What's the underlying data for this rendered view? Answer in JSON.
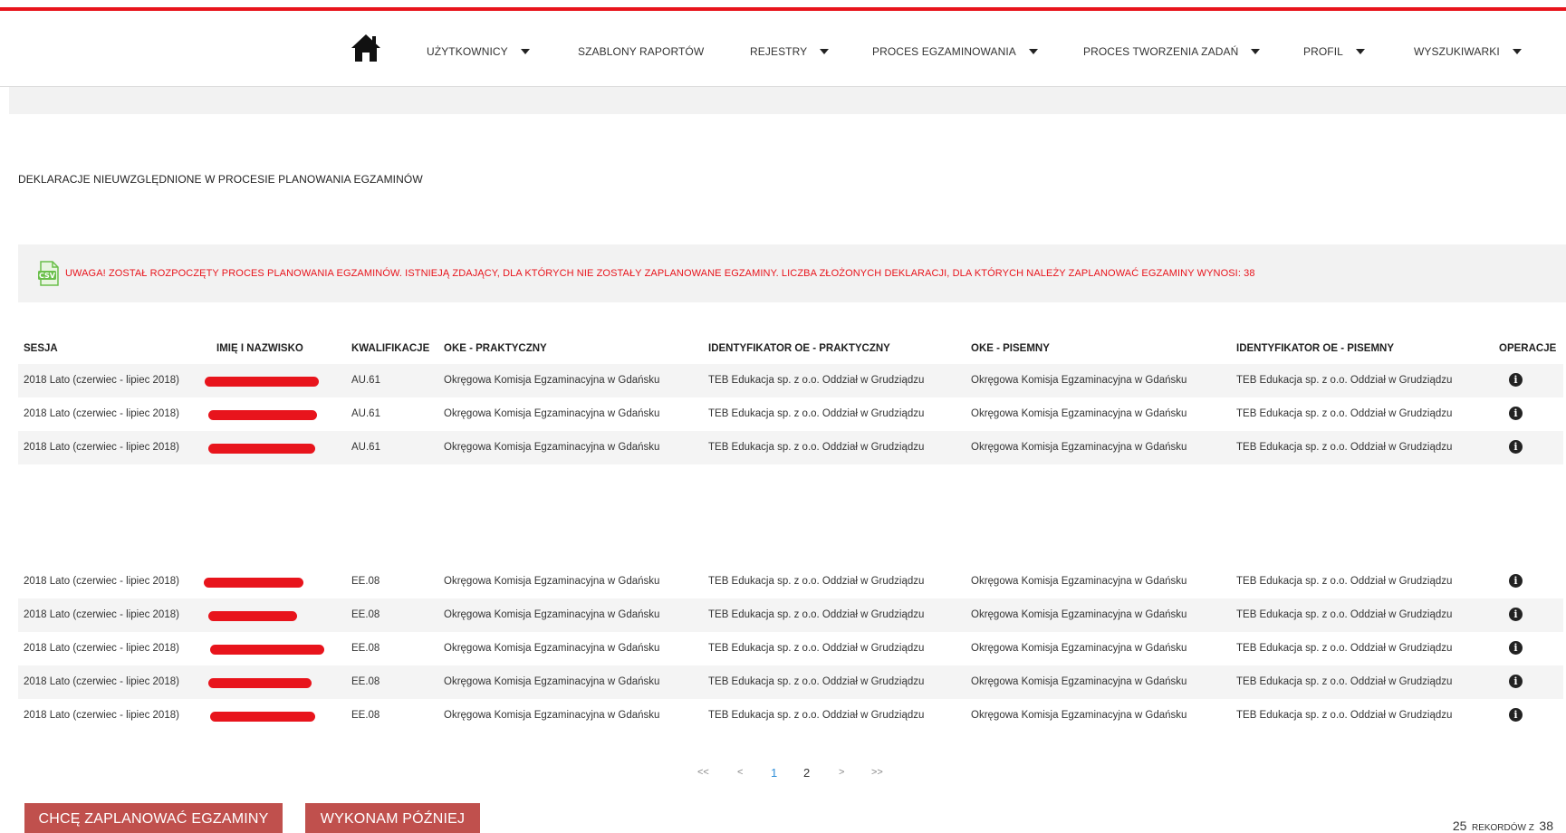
{
  "nav": {
    "items": [
      {
        "label": "UŻYTKOWNICY",
        "dropdown": true
      },
      {
        "label": "SZABLONY RAPORTÓW",
        "dropdown": false
      },
      {
        "label": "REJESTRY",
        "dropdown": true
      },
      {
        "label": "PROCES EGZAMINOWANIA",
        "dropdown": true
      },
      {
        "label": "PROCES TWORZENIA ZADAŃ",
        "dropdown": true
      },
      {
        "label": "PROFIL",
        "dropdown": true
      },
      {
        "label": "WYSZUKIWARKI",
        "dropdown": true
      }
    ]
  },
  "page": {
    "title": "DEKLARACJE NIEUWZGLĘDNIONE W PROCESIE PLANOWANIA EGZAMINÓW"
  },
  "alert": {
    "icon": "csv-icon",
    "text": "UWAGA! ZOSTAŁ ROZPOCZĘTY PROCES PLANOWANIA EGZAMINÓW. ISTNIEJĄ ZDAJĄCY, DLA KTÓRYCH NIE ZOSTAŁY ZAPLANOWANE EGZAMINY. LICZBA ZŁOŻONYCH DEKLARACJI, DLA KTÓRYCH NALEŻY ZAPLANOWAĆ EGZAMINY WYNOSI: 38"
  },
  "table": {
    "headers": [
      "SESJA",
      "IMIĘ I NAZWISKO",
      "KWALIFIKACJE",
      "OKE - PRAKTYCZNY",
      "IDENTYFIKATOR OE - PRAKTYCZNY",
      "OKE - PISEMNY",
      "IDENTYFIKATOR OE - PISEMNY",
      "OPERACJE"
    ],
    "rows": [
      {
        "sesja": "2018 Lato (czerwiec - lipiec 2018)",
        "kwalifikacje": "AU.61",
        "oke_prakt": "Okręgowa Komisja Egzaminacyjna w Gdańsku",
        "id_prakt": "TEB Edukacja sp. z o.o. Oddział w Grudziądzu",
        "oke_pis": "Okręgowa Komisja Egzaminacyjna w Gdańsku",
        "id_pis": "TEB Edukacja sp. z o.o. Oddział w Grudziądzu"
      },
      {
        "sesja": "2018 Lato (czerwiec - lipiec 2018)",
        "kwalifikacje": "AU.61",
        "oke_prakt": "Okręgowa Komisja Egzaminacyjna w Gdańsku",
        "id_prakt": "TEB Edukacja sp. z o.o. Oddział w Grudziądzu",
        "oke_pis": "Okręgowa Komisja Egzaminacyjna w Gdańsku",
        "id_pis": "TEB Edukacja sp. z o.o. Oddział w Grudziądzu"
      },
      {
        "sesja": "2018 Lato (czerwiec - lipiec 2018)",
        "kwalifikacje": "AU.61",
        "oke_prakt": "Okręgowa Komisja Egzaminacyjna w Gdańsku",
        "id_prakt": "TEB Edukacja sp. z o.o. Oddział w Grudziądzu",
        "oke_pis": "Okręgowa Komisja Egzaminacyjna w Gdańsku",
        "id_pis": "TEB Edukacja sp. z o.o. Oddział w Grudziądzu"
      },
      {
        "sesja": "2018 Lato (czerwiec - lipiec 2018)",
        "kwalifikacje": "EE.08",
        "oke_prakt": "Okręgowa Komisja Egzaminacyjna w Gdańsku",
        "id_prakt": "TEB Edukacja sp. z o.o. Oddział w Grudziądzu",
        "oke_pis": "Okręgowa Komisja Egzaminacyjna w Gdańsku",
        "id_pis": "TEB Edukacja sp. z o.o. Oddział w Grudziądzu"
      },
      {
        "sesja": "2018 Lato (czerwiec - lipiec 2018)",
        "kwalifikacje": "EE.08",
        "oke_prakt": "Okręgowa Komisja Egzaminacyjna w Gdańsku",
        "id_prakt": "TEB Edukacja sp. z o.o. Oddział w Grudziądzu",
        "oke_pis": "Okręgowa Komisja Egzaminacyjna w Gdańsku",
        "id_pis": "TEB Edukacja sp. z o.o. Oddział w Grudziądzu"
      },
      {
        "sesja": "2018 Lato (czerwiec - lipiec 2018)",
        "kwalifikacje": "EE.08",
        "oke_prakt": "Okręgowa Komisja Egzaminacyjna w Gdańsku",
        "id_prakt": "TEB Edukacja sp. z o.o. Oddział w Grudziądzu",
        "oke_pis": "Okręgowa Komisja Egzaminacyjna w Gdańsku",
        "id_pis": "TEB Edukacja sp. z o.o. Oddział w Grudziądzu"
      },
      {
        "sesja": "2018 Lato (czerwiec - lipiec 2018)",
        "kwalifikacje": "EE.08",
        "oke_prakt": "Okręgowa Komisja Egzaminacyjna w Gdańsku",
        "id_prakt": "TEB Edukacja sp. z o.o. Oddział w Grudziądzu",
        "oke_pis": "Okręgowa Komisja Egzaminacyjna w Gdańsku",
        "id_pis": "TEB Edukacja sp. z o.o. Oddział w Grudziądzu"
      },
      {
        "sesja": "2018 Lato (czerwiec - lipiec 2018)",
        "kwalifikacje": "EE.08",
        "oke_prakt": "Okręgowa Komisja Egzaminacyjna w Gdańsku",
        "id_prakt": "TEB Edukacja sp. z o.o. Oddział w Grudziądzu",
        "oke_pis": "Okręgowa Komisja Egzaminacyjna w Gdańsku",
        "id_pis": "TEB Edukacja sp. z o.o. Oddział w Grudziądzu"
      }
    ]
  },
  "pager": {
    "first": "<<",
    "prev": "<",
    "pages": [
      "1",
      "2"
    ],
    "current": "1",
    "next": ">",
    "last": ">>"
  },
  "actions": {
    "plan_label": "CHCĘ ZAPLANOWAĆ EGZAMINY",
    "later_label": "WYKONAM PÓŹNIEJ"
  },
  "records": {
    "per_page": "25",
    "label": "REKORDÓW Z",
    "total": "38"
  },
  "colors": {
    "accent_red": "#e8141c",
    "button": "#c0504d",
    "active_page": "#2f8fd8"
  }
}
